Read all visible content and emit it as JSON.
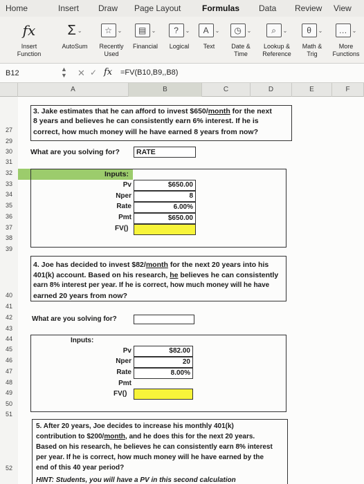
{
  "tabs": [
    "Home",
    "Insert",
    "Draw",
    "Page Layout",
    "Formulas",
    "Data",
    "Review",
    "View"
  ],
  "active_tab": "Formulas",
  "ribbon": {
    "insert_function": "Insert\nFunction",
    "autosum": "AutoSum",
    "recently_used": "Recently\nUsed",
    "financial": "Financial",
    "logical": "Logical",
    "text": "Text",
    "date_time": "Date &\nTime",
    "lookup": "Lookup &\nReference",
    "math": "Math &\nTrig",
    "more": "More\nFunctions"
  },
  "formula_bar": {
    "name_box": "B12",
    "fx": "fx",
    "formula": "=FV(B10,B9,,B8)"
  },
  "columns": [
    "A",
    "B",
    "C",
    "D",
    "E",
    "F"
  ],
  "q3": {
    "line1": "3.  Jake estimates that he can afford to invest $650/",
    "line1_ul": "month",
    "line1_end": " for the next",
    "line2": "8 years and believes he can consistently earn  6% interest.  If he is",
    "line3": "correct, how much money will he have earned 8 years from now?",
    "solving_label": "What are you solving for?",
    "solving_value": "RATE",
    "inputs_label": "Inputs:",
    "labels": [
      "Pv",
      "Nper",
      "Rate",
      "Pmt",
      "FV()"
    ],
    "values": [
      "$650.00",
      "8",
      "6.00%",
      "$650.00",
      ""
    ]
  },
  "q4": {
    "line1": "4.  Joe has decided to invest $82/",
    "line1_ul": "month",
    "line1_end": " for the next 20 years into his",
    "line2a": "401(k) account. Based on his research, ",
    "line2_ul": "he",
    "line2b": " believes he can consistently",
    "line3": "earn 8% interest per year.  If he is correct, how much money will he have",
    "line4": "earned 20 years from now?",
    "solving_label": "What are you solving for?",
    "inputs_label": "Inputs:",
    "labels": [
      "Pv",
      "Nper",
      "Rate",
      "Pmt",
      "FV()"
    ],
    "values": [
      "$82.00",
      "20",
      "8.00%",
      "",
      ""
    ]
  },
  "q5": {
    "line1": "5.     After 20 years, Joe decides to increase his monthly 401(k)",
    "line2a": "contribution to $200/",
    "line2_ul": "month",
    "line2b": ", and he does this for the next 20 years.",
    "line3": "Based on his research, he believes he can consistently earn 8% interest",
    "line4": "per year.  If he is correct, how much money will he have earned by the",
    "line5": "end of this 40 year period?",
    "hint": "HINT: Students, you will have a PV in this second calculation"
  },
  "rows": [
    "27",
    "29",
    "30",
    "31",
    "32",
    "33",
    "34",
    "35",
    "36",
    "37",
    "38",
    "39",
    "40",
    "41",
    "42",
    "43",
    "44",
    "45",
    "46",
    "47",
    "48",
    "49",
    "50",
    "51",
    "52"
  ]
}
